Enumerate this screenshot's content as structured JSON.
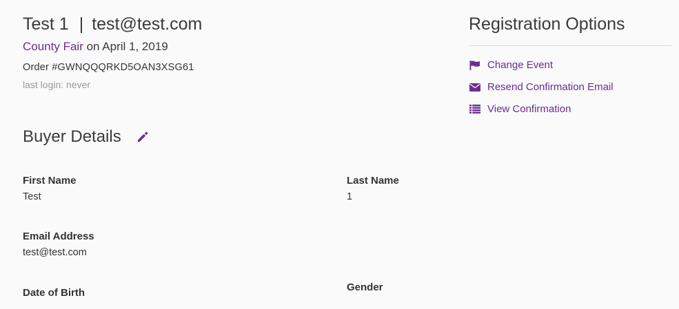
{
  "header": {
    "name": "Test 1",
    "separator": "|",
    "email": "test@test.com",
    "event_name": "County Fair",
    "event_date_text": " on April 1, 2019",
    "order": "Order #GWNQQQRKD5OAN3XSG61",
    "last_login": "last login: never"
  },
  "buyer_details": {
    "title": "Buyer Details",
    "edit_icon": "pencil-icon",
    "fields": {
      "first_name": {
        "label": "First Name",
        "value": "Test"
      },
      "last_name": {
        "label": "Last Name",
        "value": "1"
      },
      "email": {
        "label": "Email Address",
        "value": "test@test.com"
      },
      "dob": {
        "label": "Date of Birth",
        "value": ""
      },
      "gender": {
        "label": "Gender",
        "value": ""
      }
    }
  },
  "registration_options": {
    "title": "Registration Options",
    "items": [
      {
        "label": "Change Event",
        "icon": "flag-icon"
      },
      {
        "label": "Resend Confirmation Email",
        "icon": "envelope-icon"
      },
      {
        "label": "View Confirmation",
        "icon": "list-icon"
      }
    ]
  },
  "colors": {
    "accent": "#6a2c91",
    "text": "#333333",
    "muted": "#9a9a9a",
    "background": "#fafafa"
  }
}
